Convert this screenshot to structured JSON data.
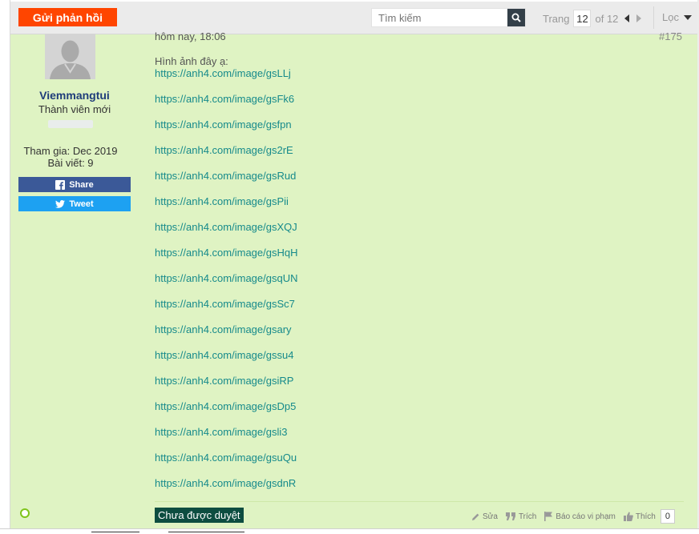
{
  "toolbar": {
    "reply_label": "Gửi phản hồi",
    "search_placeholder": "Tìm kiếm",
    "page_label": "Trang",
    "current_page": "12",
    "total_pages_label": "of 12",
    "filter_label": "Lọc"
  },
  "author": {
    "username": "Viemmangtui",
    "title": "Thành viên mới",
    "joined": "Tham gia: Dec 2019",
    "posts": "Bài viết: 9",
    "share_label": "Share",
    "tweet_label": "Tweet"
  },
  "post": {
    "timestamp": "hôm nay, 18:06",
    "number": "#175",
    "intro": "Hình ảnh đây ạ:",
    "links": [
      "https://anh4.com/image/gsLLj",
      "https://anh4.com/image/gsFk6",
      "https://anh4.com/image/gsfpn",
      "https://anh4.com/image/gs2rE",
      "https://anh4.com/image/gsRud",
      "https://anh4.com/image/gsPii",
      "https://anh4.com/image/gsXQJ",
      "https://anh4.com/image/gsHqH",
      "https://anh4.com/image/gsqUN",
      "https://anh4.com/image/gsSc7",
      "https://anh4.com/image/gsary",
      "https://anh4.com/image/gssu4",
      "https://anh4.com/image/gsiRP",
      "https://anh4.com/image/gsDp5",
      "https://anh4.com/image/gsli3",
      "https://anh4.com/image/gsuQu",
      "https://anh4.com/image/gsdnR"
    ],
    "status": "Chưa được duyệt",
    "actions": {
      "edit": "Sửa",
      "quote": "Trích",
      "report": "Báo cáo vi phạm",
      "like": "Thích",
      "like_count": "0"
    }
  },
  "colors": {
    "post_background": "#dff3c3",
    "reply_button": "#ff4500",
    "link": "#168a8b",
    "username": "#1e3c7a",
    "status_badge": "#0d4d40",
    "facebook": "#3b5998",
    "twitter": "#1da1f2"
  }
}
